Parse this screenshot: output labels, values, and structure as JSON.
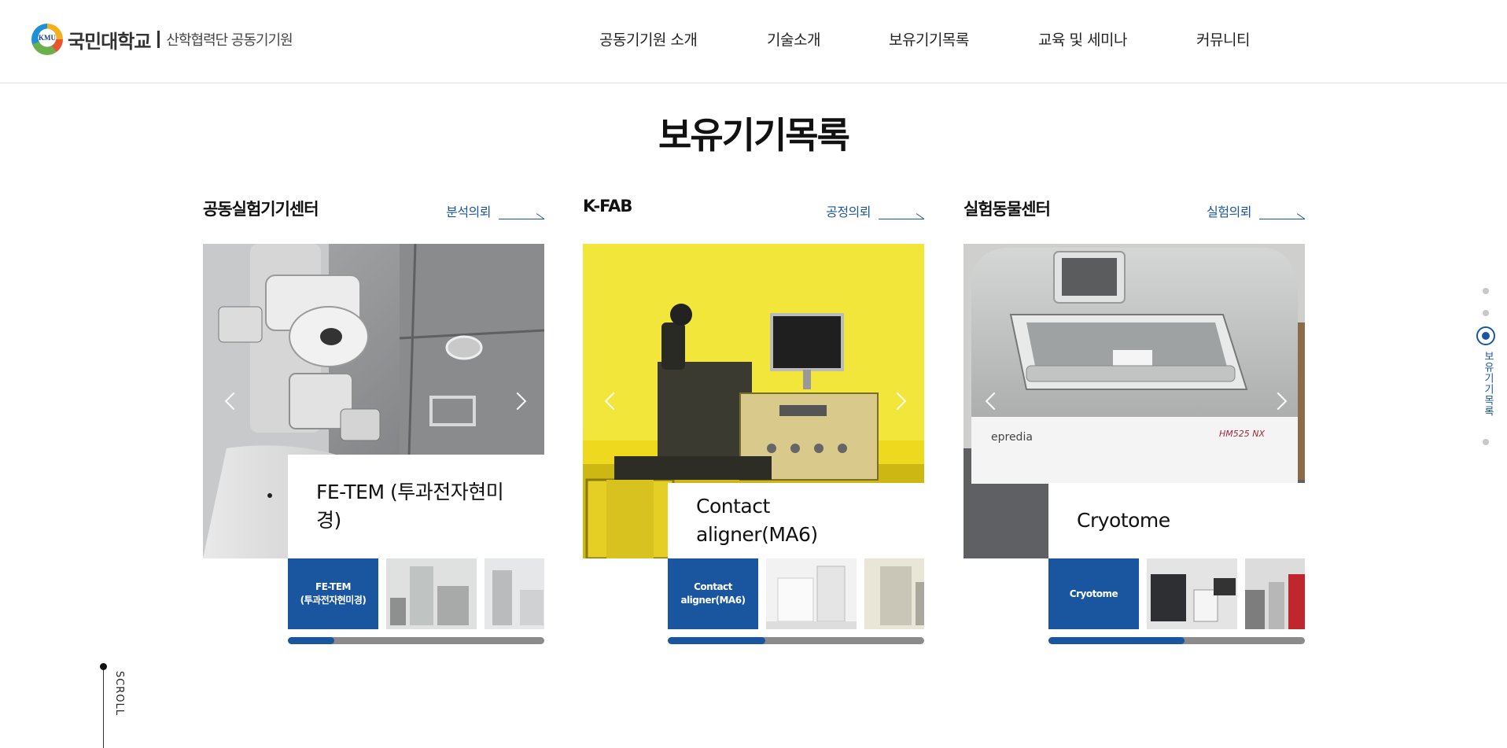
{
  "logo": {
    "emblem_text": "KMU",
    "name": "국민대학교",
    "subtitle": "산학협력단 공동기기원"
  },
  "nav": {
    "items": [
      {
        "label": "공동기기원 소개"
      },
      {
        "label": "기술소개"
      },
      {
        "label": "보유기기목록"
      },
      {
        "label": "교육 및 세미나"
      },
      {
        "label": "커뮤니티"
      }
    ]
  },
  "page_title": "보유기기목록",
  "columns": [
    {
      "title": "공동실험기기센터",
      "link_label": "분석의뢰",
      "caption": "FE-TEM (투과전자현미경)",
      "active_thumb": "FE-TEM\n(투과전자현미경)",
      "progress": 0.18
    },
    {
      "title": "K-FAB",
      "link_label": "공정의뢰",
      "caption": "Contact aligner(MA6)",
      "active_thumb": "Contact\naligner(MA6)",
      "progress": 0.38
    },
    {
      "title": "실험동물센터",
      "link_label": "실험의뢰",
      "caption": "Cryotome",
      "active_thumb": "Cryotome",
      "progress": 0.53
    }
  ],
  "side_nav": {
    "active_label": "보유기기목록"
  },
  "scroll_label": "SCROLL",
  "colors": {
    "accent": "#1a56a0",
    "progress_track": "#8b8b8b",
    "header_border": "#e3e3e3"
  },
  "icons": {
    "prev": "chevron-left-icon",
    "next": "chevron-right-icon",
    "link_arrow": "long-arrow-right-icon"
  }
}
